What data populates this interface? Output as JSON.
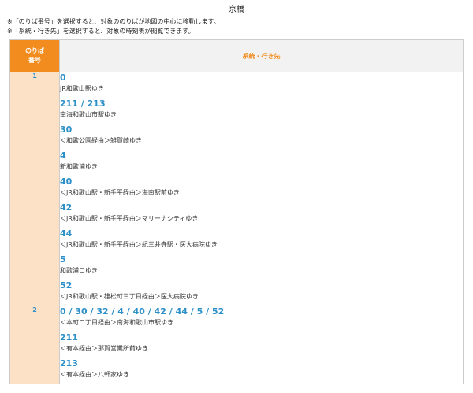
{
  "station": {
    "title": "京橋"
  },
  "notes": [
    "※「のりば番号」を選択すると、対象ののりばが地図の中心に移動します。",
    "※「系統・行き先」を選択すると、対象の時刻表が閲覧できます。"
  ],
  "table": {
    "header": {
      "platform_line1": "のりば",
      "platform_line2": "番号",
      "route": "系統・行き先"
    },
    "platforms": [
      {
        "number": "1",
        "routes": [
          {
            "num": "0",
            "dest": "JR和歌山駅ゆき"
          },
          {
            "num": "211 / 213",
            "dest": "南海和歌山市駅ゆき"
          },
          {
            "num": "30",
            "dest": "＜和歌公園経由＞雑賀崎ゆき"
          },
          {
            "num": "4",
            "dest": "新和歌浦ゆき"
          },
          {
            "num": "40",
            "dest": "＜JR和歌山駅・新手平経由＞海南駅前ゆき"
          },
          {
            "num": "42",
            "dest": "＜JR和歌山駅・新手平経由＞マリーナシティゆき"
          },
          {
            "num": "44",
            "dest": "＜JR和歌山駅・新手平経由＞紀三井寺駅・医大病院ゆき"
          },
          {
            "num": "5",
            "dest": "和歌浦口ゆき"
          },
          {
            "num": "52",
            "dest": "＜JR和歌山駅・雄松町三丁目経由＞医大病院ゆき"
          }
        ]
      },
      {
        "number": "2",
        "routes": [
          {
            "num": "0 / 30 / 32 / 4 / 40 / 42 / 44 / 5 / 52",
            "dest": "＜本町二丁目経由＞南海和歌山市駅ゆき"
          },
          {
            "num": "211",
            "dest": "＜有本経由＞那賀営業所前ゆき"
          },
          {
            "num": "213",
            "dest": "＜有本経由＞八軒家ゆき"
          }
        ]
      }
    ]
  }
}
